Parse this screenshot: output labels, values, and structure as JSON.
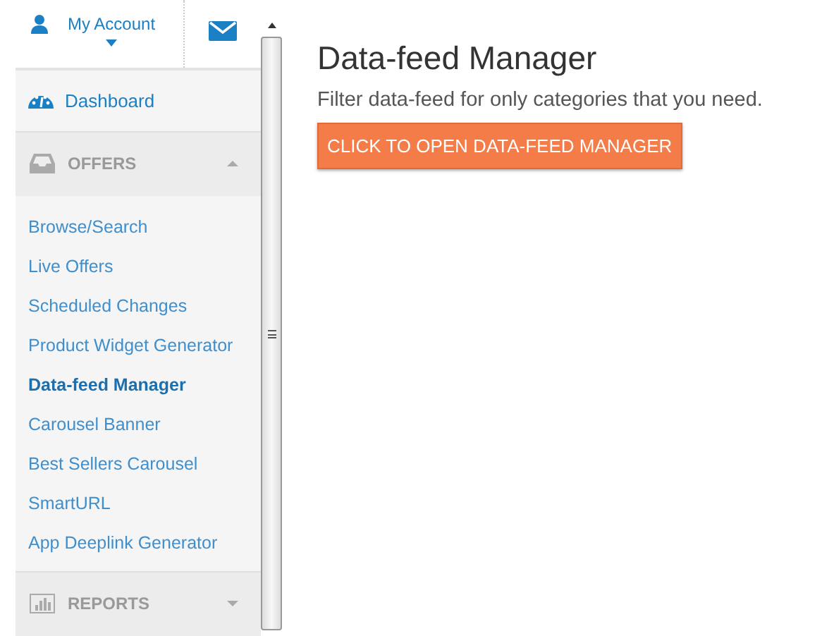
{
  "account": {
    "label": "My Account"
  },
  "dashboard": {
    "label": "Dashboard"
  },
  "sections": [
    {
      "kind": "offers",
      "label": "OFFERS",
      "expanded": true,
      "items": [
        {
          "label": "Browse/Search",
          "selected": false
        },
        {
          "label": "Live Offers",
          "selected": false
        },
        {
          "label": "Scheduled Changes",
          "selected": false
        },
        {
          "label": "Product Widget Generator",
          "selected": false
        },
        {
          "label": "Data-feed Manager",
          "selected": true
        },
        {
          "label": "Carousel Banner",
          "selected": false
        },
        {
          "label": "Best Sellers Carousel",
          "selected": false
        },
        {
          "label": "SmartURL",
          "selected": false
        },
        {
          "label": "App Deeplink Generator",
          "selected": false
        }
      ]
    },
    {
      "kind": "reports",
      "label": "REPORTS",
      "expanded": false
    }
  ],
  "main": {
    "title": "Data-feed Manager",
    "description": "Filter data-feed for only categories that you need.",
    "button": "CLICK TO OPEN DATA-FEED MANAGER"
  }
}
